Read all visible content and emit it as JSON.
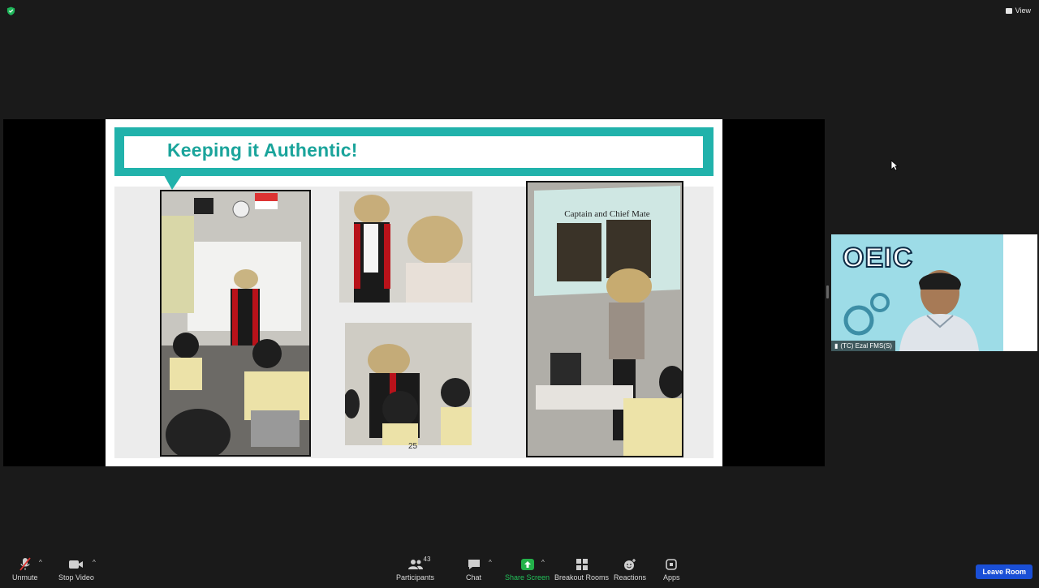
{
  "topbar": {
    "view_label": "View"
  },
  "slide": {
    "title": "Keeping it Authentic!",
    "page_number": "25",
    "photo_caption": "Captain and Chief Mate"
  },
  "participant": {
    "name": "(TC) Ezal FMS(S)",
    "logo_text": "OEIC"
  },
  "toolbar": {
    "unmute": "Unmute",
    "stop_video": "Stop Video",
    "participants": "Participants",
    "participants_count": "43",
    "chat": "Chat",
    "share_screen": "Share Screen",
    "breakout_rooms": "Breakout Rooms",
    "reactions": "Reactions",
    "apps": "Apps",
    "leave_room": "Leave Room"
  },
  "colors": {
    "teal": "#21b2ab",
    "share_green": "#23b14a",
    "leave_blue": "#1a4fd6"
  }
}
